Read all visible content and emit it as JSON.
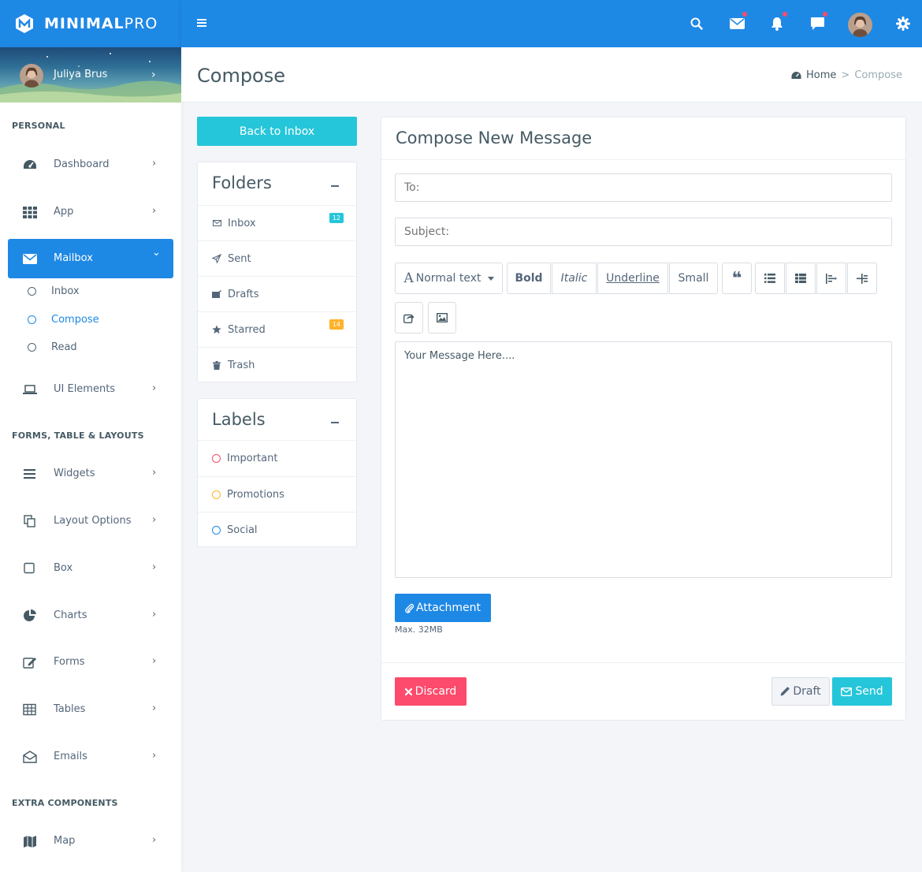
{
  "brand": {
    "name_bold": "MINIMAL",
    "name_light": "PRO"
  },
  "topbar": {
    "icons": [
      "search-icon",
      "envelope-icon",
      "bell-icon",
      "chat-icon",
      "user-avatar",
      "gear-icon"
    ],
    "accent": "#1e88e5",
    "notification_dot": "#fc4b6c"
  },
  "user": {
    "name": "Juliya Brus",
    "chevron": "›"
  },
  "sidebar": {
    "sections": {
      "personal": "PERSONAL",
      "forms": "FORMS, TABLE & LAYOUTS",
      "extra": "EXTRA COMPONENTS"
    },
    "items": [
      {
        "label": "Dashboard",
        "icon": "dashboard-icon"
      },
      {
        "label": "App",
        "icon": "grid-icon"
      },
      {
        "label": "Mailbox",
        "icon": "envelope-icon",
        "active": true
      },
      {
        "label": "UI Elements",
        "icon": "laptop-icon"
      },
      {
        "label": "Widgets",
        "icon": "bars-icon"
      },
      {
        "label": "Layout Options",
        "icon": "copy-icon"
      },
      {
        "label": "Box",
        "icon": "square-icon"
      },
      {
        "label": "Charts",
        "icon": "pie-icon"
      },
      {
        "label": "Forms",
        "icon": "edit-icon"
      },
      {
        "label": "Tables",
        "icon": "table-icon"
      },
      {
        "label": "Emails",
        "icon": "envelope-open-icon"
      },
      {
        "label": "Map",
        "icon": "map-icon"
      }
    ],
    "mailbox_sub": [
      {
        "label": "Inbox"
      },
      {
        "label": "Compose",
        "current": true
      },
      {
        "label": "Read"
      }
    ],
    "chevron_right": "›",
    "chevron_down": "⌄"
  },
  "page": {
    "title": "Compose",
    "breadcrumb": {
      "home": "Home",
      "separator": ">",
      "current": "Compose"
    }
  },
  "left": {
    "back_button": "Back to Inbox",
    "folders": {
      "title": "Folders",
      "items": [
        {
          "label": "Inbox",
          "icon": "envelope-icon",
          "badge": "12",
          "badge_color": "#26c6da"
        },
        {
          "label": "Sent",
          "icon": "paper-plane-icon"
        },
        {
          "label": "Drafts",
          "icon": "drafts-icon"
        },
        {
          "label": "Starred",
          "icon": "star-icon",
          "badge": "14",
          "badge_color": "#ffb22b"
        },
        {
          "label": "Trash",
          "icon": "trash-icon"
        }
      ]
    },
    "labels": {
      "title": "Labels",
      "items": [
        {
          "label": "Important",
          "color": "#fc4b6c"
        },
        {
          "label": "Promotions",
          "color": "#ffb22b"
        },
        {
          "label": "Social",
          "color": "#1e88e5"
        }
      ]
    }
  },
  "compose": {
    "title": "Compose New Message",
    "to_placeholder": "To:",
    "subject_placeholder": "Subject:",
    "toolbar": {
      "text_style_glyph": "A",
      "text_style": "Normal text",
      "bold": "Bold",
      "italic": "Italic",
      "underline": "Underline",
      "small": "Small",
      "quote_glyph": "❝"
    },
    "message_placeholder": "Your Message Here....",
    "attachment_button": "Attachment",
    "max_size": "Max. 32MB",
    "discard_button": "Discard",
    "draft_button": "Draft",
    "send_button": "Send"
  }
}
